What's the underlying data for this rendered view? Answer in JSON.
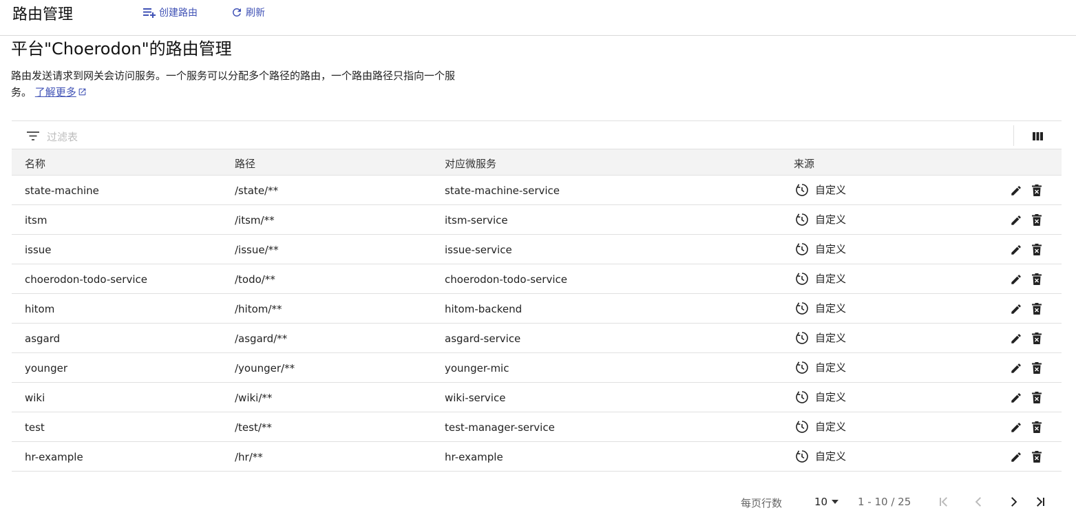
{
  "header": {
    "title": "路由管理",
    "create_label": "创建路由",
    "refresh_label": "刷新"
  },
  "page": {
    "heading": "平台\"Choerodon\"的路由管理",
    "description": "路由发送请求到网关会访问服务。一个服务可以分配多个路径的路由，一个路由路径只指向一个服务。",
    "learn_more": "了解更多"
  },
  "filter": {
    "placeholder": "过滤表"
  },
  "columns": {
    "name": "名称",
    "path": "路径",
    "service": "对应微服务",
    "source": "来源"
  },
  "rows": [
    {
      "name": "state-machine",
      "path": "/state/**",
      "service": "state-machine-service",
      "source": "自定义"
    },
    {
      "name": "itsm",
      "path": "/itsm/**",
      "service": "itsm-service",
      "source": "自定义"
    },
    {
      "name": "issue",
      "path": "/issue/**",
      "service": "issue-service",
      "source": "自定义"
    },
    {
      "name": "choerodon-todo-service",
      "path": "/todo/**",
      "service": "choerodon-todo-service",
      "source": "自定义"
    },
    {
      "name": "hitom",
      "path": "/hitom/**",
      "service": "hitom-backend",
      "source": "自定义"
    },
    {
      "name": "asgard",
      "path": "/asgard/**",
      "service": "asgard-service",
      "source": "自定义"
    },
    {
      "name": "younger",
      "path": "/younger/**",
      "service": "younger-mic",
      "source": "自定义"
    },
    {
      "name": "wiki",
      "path": "/wiki/**",
      "service": "wiki-service",
      "source": "自定义"
    },
    {
      "name": "test",
      "path": "/test/**",
      "service": "test-manager-service",
      "source": "自定义"
    },
    {
      "name": "hr-example",
      "path": "/hr/**",
      "service": "hr-example",
      "source": "自定义"
    }
  ],
  "pagination": {
    "rows_per_page_label": "每页行数",
    "rows_per_page": "10",
    "range": "1 - 10 / 25"
  },
  "colors": {
    "accent": "#3f51b5",
    "header_bg": "#f3f3f3",
    "border": "#e0e0e0"
  }
}
